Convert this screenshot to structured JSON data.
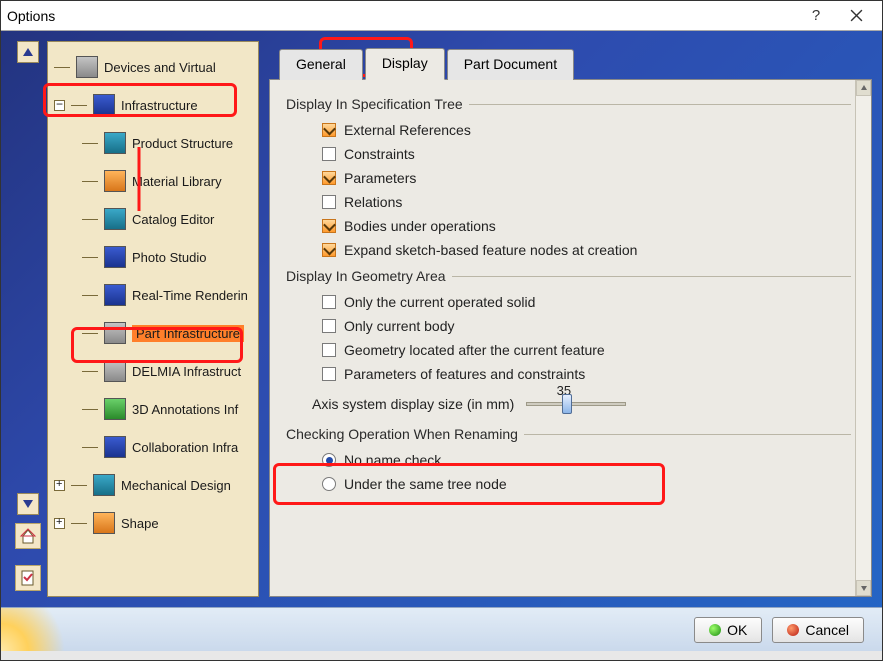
{
  "window": {
    "title": "Options"
  },
  "tree": {
    "top_item": {
      "label": "Devices and Virtual"
    },
    "infra_label": "Infrastructure",
    "children": [
      {
        "label": "Product Structure"
      },
      {
        "label": "Material Library"
      },
      {
        "label": "Catalog Editor"
      },
      {
        "label": "Photo Studio"
      },
      {
        "label": "Real-Time Renderin"
      },
      {
        "label": "Part Infrastructure"
      },
      {
        "label": "DELMIA Infrastruct"
      },
      {
        "label": "3D Annotations Inf"
      },
      {
        "label": "Collaboration Infra"
      }
    ],
    "mech_label": "Mechanical Design",
    "shape_label": "Shape"
  },
  "tabs": {
    "general": "General",
    "display": "Display",
    "partdoc": "Part Document"
  },
  "spec_section": {
    "title": "Display In Specification Tree",
    "items": [
      {
        "label": "External References",
        "checked": true
      },
      {
        "label": "Constraints",
        "checked": false
      },
      {
        "label": "Parameters",
        "checked": true
      },
      {
        "label": "Relations",
        "checked": false
      },
      {
        "label": "Bodies under operations",
        "checked": true
      },
      {
        "label": "Expand sketch-based feature nodes at creation",
        "checked": true
      }
    ]
  },
  "geom_section": {
    "title": "Display In Geometry Area",
    "items": [
      {
        "label": "Only the current operated solid"
      },
      {
        "label": "Only current body"
      },
      {
        "label": "Geometry located after the current feature"
      },
      {
        "label": "Parameters of features and constraints"
      }
    ],
    "axis_label": "Axis system display size (in mm)",
    "axis_value": "35"
  },
  "rename_section": {
    "title": "Checking Operation When Renaming",
    "no_name": "No name check",
    "same_tree": "Under the same tree node"
  },
  "buttons": {
    "ok": "OK",
    "cancel": "Cancel"
  }
}
